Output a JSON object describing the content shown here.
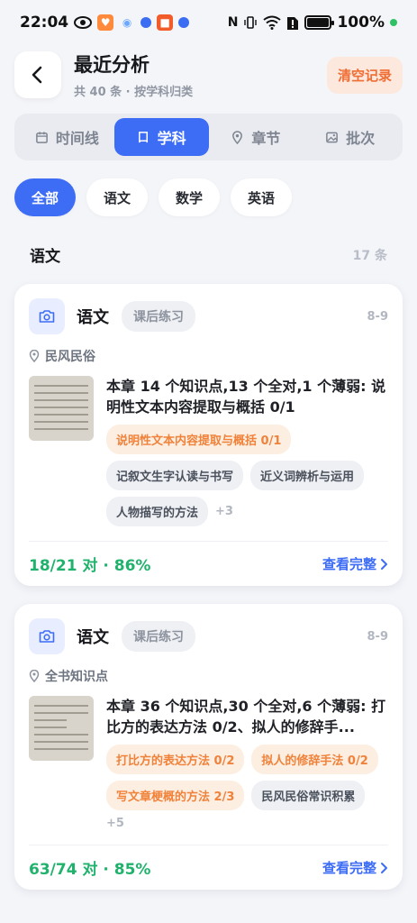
{
  "status_bar": {
    "time": "22:04",
    "battery": "100%"
  },
  "header": {
    "title": "最近分析",
    "subtitle": "共 40 条 · 按学科归类",
    "clear_label": "清空记录"
  },
  "tabs": [
    {
      "label": "时间线",
      "icon": "calendar-icon",
      "active": false
    },
    {
      "label": "学科",
      "icon": "book-icon",
      "active": true
    },
    {
      "label": "章节",
      "icon": "location-pin-icon",
      "active": false
    },
    {
      "label": "批次",
      "icon": "image-icon",
      "active": false
    }
  ],
  "filter_chips": [
    {
      "label": "全部",
      "active": true
    },
    {
      "label": "语文",
      "active": false
    },
    {
      "label": "数学",
      "active": false
    },
    {
      "label": "英语",
      "active": false
    }
  ],
  "section": {
    "title": "语文",
    "count": "17 条"
  },
  "cards": [
    {
      "subject": "语文",
      "tag": "课后练习",
      "date": "8-9",
      "chapter": "民风民俗",
      "summary": "本章 14 个知识点,13 个全对,1 个薄弱: 说明性文本内容提取与概括 0/1",
      "pills": [
        {
          "label": "说明性文本内容提取与概括 0/1",
          "weak": true
        },
        {
          "label": "记叙文生字认读与书写",
          "weak": false
        },
        {
          "label": "近义词辨析与运用",
          "weak": false
        },
        {
          "label": "人物描写的方法",
          "weak": false
        }
      ],
      "more": "+3",
      "score": "18/21 对 · 86%",
      "view_label": "查看完整"
    },
    {
      "subject": "语文",
      "tag": "课后练习",
      "date": "8-9",
      "chapter": "全书知识点",
      "summary": "本章 36 个知识点,30 个全对,6 个薄弱: 打比方的表达方法 0/2、拟人的修辞手...",
      "pills": [
        {
          "label": "打比方的表达方法 0/2",
          "weak": true
        },
        {
          "label": "拟人的修辞手法 0/2",
          "weak": true
        },
        {
          "label": "写文章梗概的方法 2/3",
          "weak": true
        },
        {
          "label": "民风民俗常识积累",
          "weak": false
        }
      ],
      "more": "+5",
      "score": "63/74 对 · 85%",
      "view_label": "查看完整"
    }
  ],
  "colors": {
    "accent": "#3d6cf5",
    "success": "#20b26c",
    "warning": "#f0823a"
  }
}
